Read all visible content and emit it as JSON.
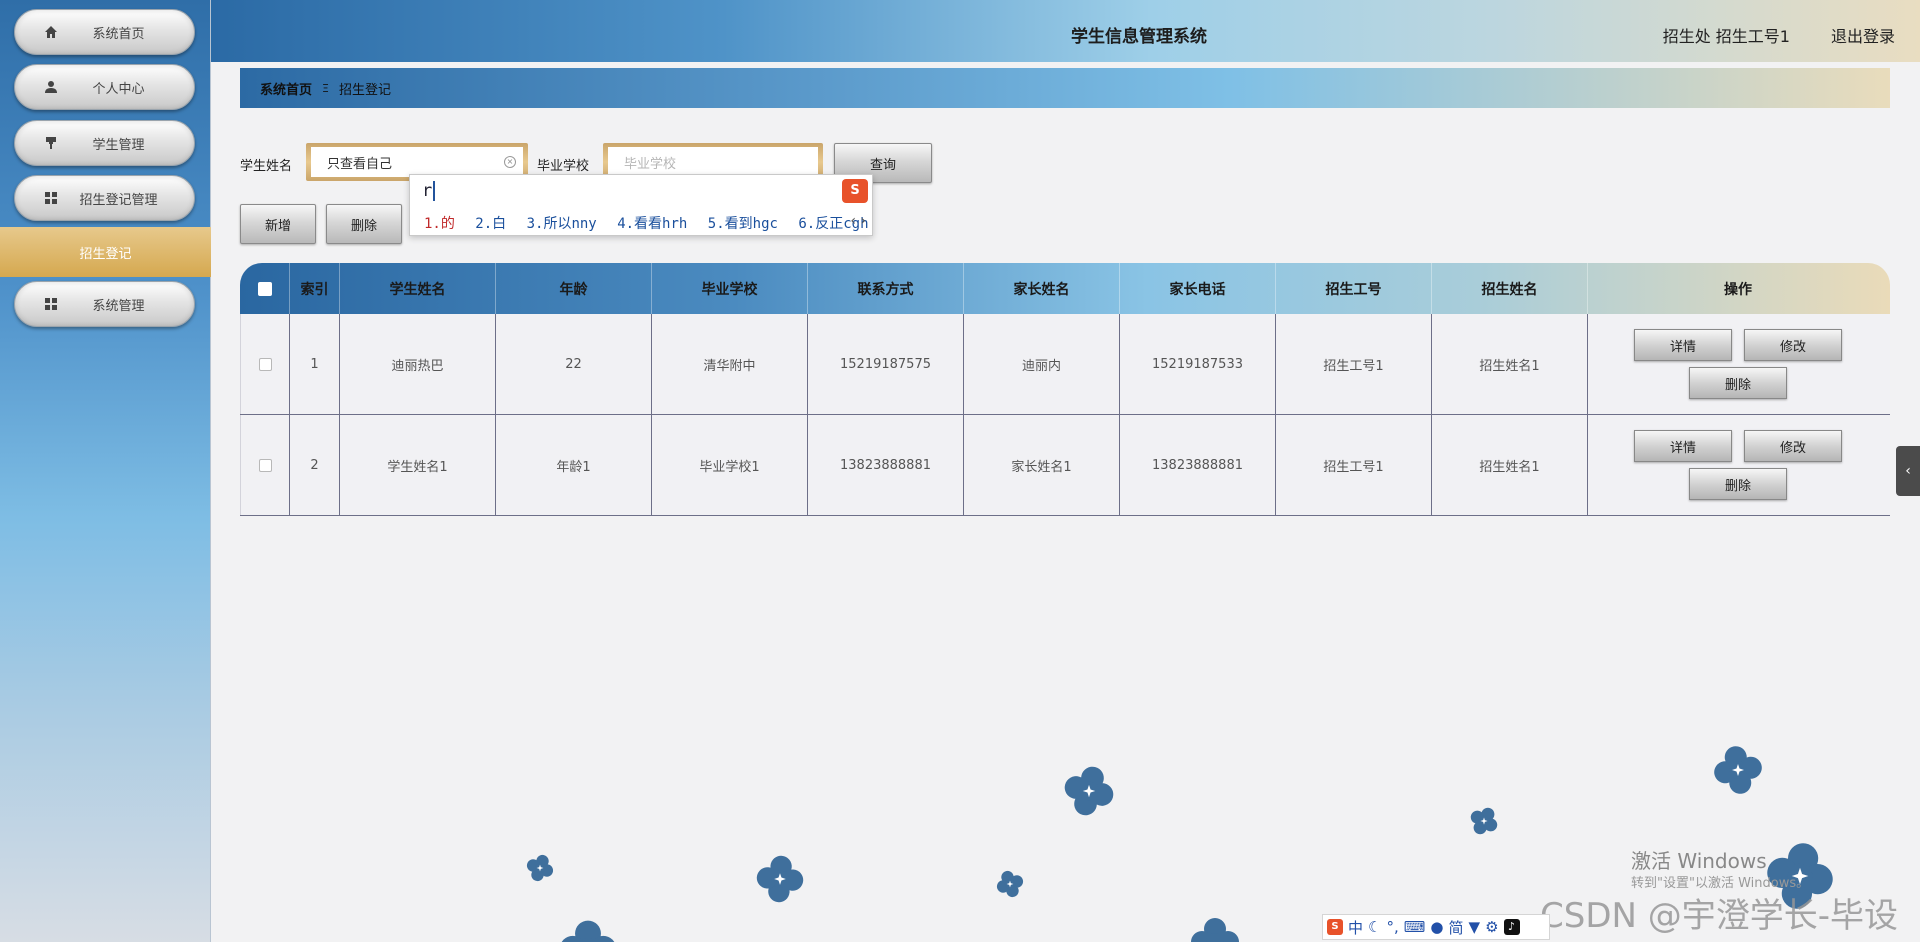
{
  "sidebar": {
    "items": [
      {
        "label": "系统首页",
        "icon": "home-icon"
      },
      {
        "label": "个人中心",
        "icon": "user-icon"
      },
      {
        "label": "学生管理",
        "icon": "brush-icon"
      },
      {
        "label": "招生登记管理",
        "icon": "grid-icon"
      },
      {
        "label": "系统管理",
        "icon": "grid-icon"
      }
    ],
    "active_sub": "招生登记"
  },
  "header": {
    "title": "学生信息管理系统",
    "user": "招生处 招生工号1",
    "logout": "退出登录"
  },
  "breadcrumb": {
    "home": "系统首页",
    "sep": "Ξ",
    "current": "招生登记"
  },
  "search": {
    "name_label": "学生姓名",
    "name_value": "只查看自己",
    "school_label": "毕业学校",
    "school_placeholder": "毕业学校",
    "query_button": "查询"
  },
  "actions": {
    "add_button": "新增",
    "delete_button": "删除"
  },
  "ime": {
    "typed": "r",
    "logo": "S",
    "candidates": [
      "1.的",
      "2.白",
      "3.所以nny",
      "4.看看hrh",
      "5.看到hgc",
      "6.反正cgh"
    ]
  },
  "table": {
    "headers": [
      "索引",
      "学生姓名",
      "年龄",
      "毕业学校",
      "联系方式",
      "家长姓名",
      "家长电话",
      "招生工号",
      "招生姓名",
      "操作"
    ],
    "rows": [
      {
        "index": "1",
        "name": "迪丽热巴",
        "age": "22",
        "school": "清华附中",
        "phone": "15219187575",
        "parent": "迪丽内",
        "parent_phone": "15219187533",
        "staff_id": "招生工号1",
        "staff_name": "招生姓名1"
      },
      {
        "index": "2",
        "name": "学生姓名1",
        "age": "年龄1",
        "school": "毕业学校1",
        "phone": "13823888881",
        "parent": "家长姓名1",
        "parent_phone": "13823888881",
        "staff_id": "招生工号1",
        "staff_name": "招生姓名1"
      }
    ],
    "op_labels": {
      "detail": "详情",
      "edit": "修改",
      "delete": "删除"
    }
  },
  "watermark": {
    "windows_line1": "激活 Windows",
    "windows_line2": "转到\"设置\"以激活 Windows。",
    "csdn": "CSDN @宇澄学长-毕设"
  },
  "ime_bar": [
    "中",
    "简"
  ],
  "colors": {
    "accent_blue": "#2b6aa5",
    "gold": "#d5a84f",
    "flower": "#3f6f9c"
  }
}
